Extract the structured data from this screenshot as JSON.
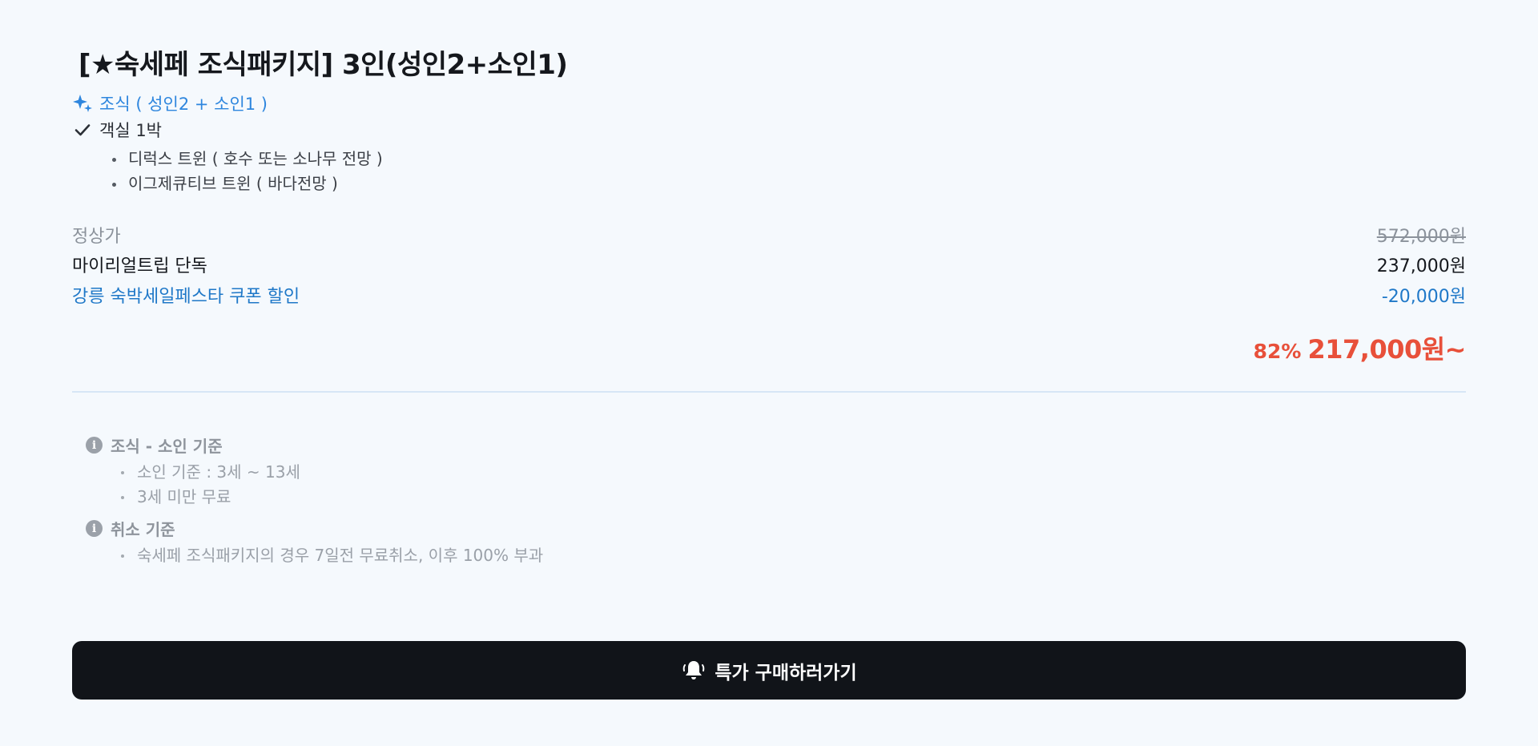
{
  "product": {
    "title": "[★숙세페 조식패키지] 3인(성인2+소인1)",
    "features": {
      "breakfast": {
        "icon": "sparkle-icon",
        "label": "조식 ( 성인2 + 소인1 )"
      },
      "room": {
        "icon": "check-icon",
        "label": "객실 1박"
      }
    },
    "room_types": [
      "디럭스 트윈 ( 호수 또는 소나무 전망 )",
      "이그제큐티브 트윈 ( 바다전망 )"
    ]
  },
  "pricing": {
    "regular": {
      "label": "정상가",
      "value": "572,000원"
    },
    "member": {
      "label": "마이리얼트립 단독",
      "value": "237,000원"
    },
    "coupon": {
      "label": "강릉 숙박세일페스타 쿠폰 할인",
      "value": "-20,000원"
    },
    "final": {
      "discount": "82%",
      "amount": "217,000원~"
    }
  },
  "notes": [
    {
      "icon": "info-icon",
      "title": "조식 - 소인 기준",
      "items": [
        "소인 기준 : 3세 ~ 13세",
        "3세 미만 무료"
      ]
    },
    {
      "icon": "info-icon",
      "title": "취소 기준",
      "items": [
        "숙세페 조식패키지의 경우 7일전 무료취소, 이후 100% 부과"
      ]
    }
  ],
  "cta": {
    "icon": "bell-icon",
    "label": "특가 구매하러가기"
  },
  "colors": {
    "background": "#f5f9fd",
    "accent_blue": "#2e86de",
    "coupon_blue": "#1f78c8",
    "price_red": "#e8503a",
    "button_dark": "#111419"
  }
}
